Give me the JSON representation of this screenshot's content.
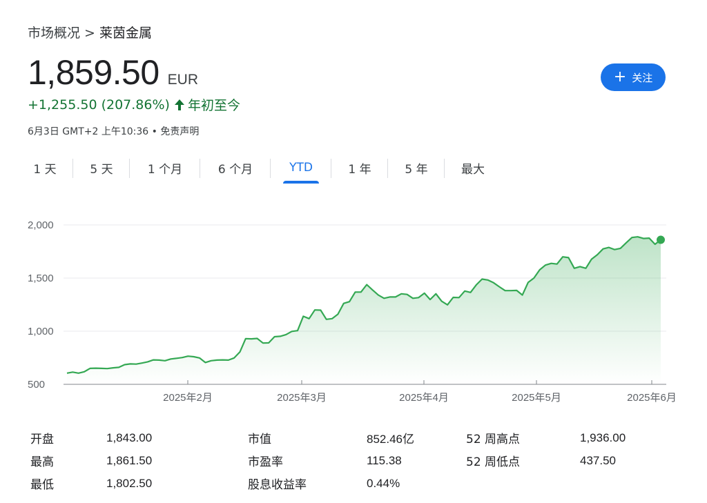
{
  "breadcrumb": {
    "parent": "市场概况",
    "separator": ">",
    "current": "莱茵金属"
  },
  "quote": {
    "price": "1,859.50",
    "currency": "EUR",
    "change": "+1,255.50 (207.86%)",
    "period": "年初至今",
    "timestamp": "6月3日 GMT+2 上午10:36 • 免责声明"
  },
  "follow_button": {
    "label": "关注",
    "icon": "plus-icon"
  },
  "tabs": [
    {
      "label": "1 天",
      "active": false
    },
    {
      "label": "5 天",
      "active": false
    },
    {
      "label": "1 个月",
      "active": false
    },
    {
      "label": "6 个月",
      "active": false
    },
    {
      "label": "YTD",
      "active": true
    },
    {
      "label": "1 年",
      "active": false
    },
    {
      "label": "5 年",
      "active": false
    },
    {
      "label": "最大",
      "active": false
    }
  ],
  "chart_data": {
    "type": "area",
    "y_ticks": [
      "2,000",
      "1,500",
      "1,000",
      "500"
    ],
    "x_labels": [
      "2025年2月",
      "2025年3月",
      "2025年4月",
      "2025年5月",
      "2025年6月"
    ],
    "ylim": [
      500,
      2000
    ],
    "grid": true,
    "color": "#34a853",
    "series": [
      {
        "values": [
          605,
          615,
          605,
          618,
          650,
          652,
          650,
          648,
          655,
          660,
          685,
          692,
          690,
          700,
          712,
          730,
          728,
          722,
          738,
          745,
          752,
          765,
          760,
          748,
          705,
          722,
          728,
          730,
          728,
          748,
          805,
          930,
          928,
          932,
          888,
          890,
          948,
          952,
          968,
          998,
          1005,
          1140,
          1118,
          1200,
          1198,
          1112,
          1118,
          1160,
          1262,
          1278,
          1368,
          1368,
          1438,
          1388,
          1340,
          1310,
          1322,
          1322,
          1352,
          1346,
          1310,
          1316,
          1358,
          1298,
          1352,
          1282,
          1248,
          1318,
          1316,
          1378,
          1365,
          1436,
          1490,
          1482,
          1456,
          1418,
          1382,
          1382,
          1384,
          1340,
          1460,
          1500,
          1578,
          1622,
          1638,
          1632,
          1700,
          1692,
          1592,
          1608,
          1592,
          1678,
          1720,
          1775,
          1788,
          1768,
          1780,
          1832,
          1882,
          1888,
          1873,
          1876,
          1818,
          1860
        ]
      }
    ]
  },
  "stats": [
    [
      {
        "label": "开盘",
        "value": "1,843.00"
      },
      {
        "label": "市值",
        "value": "852.46亿"
      },
      {
        "label": "52 周高点",
        "value": "1,936.00"
      }
    ],
    [
      {
        "label": "最高",
        "value": "1,861.50"
      },
      {
        "label": "市盈率",
        "value": "115.38"
      },
      {
        "label": "52 周低点",
        "value": "437.50"
      }
    ],
    [
      {
        "label": "最低",
        "value": "1,802.50"
      },
      {
        "label": "股息收益率",
        "value": "0.44%"
      }
    ]
  ]
}
